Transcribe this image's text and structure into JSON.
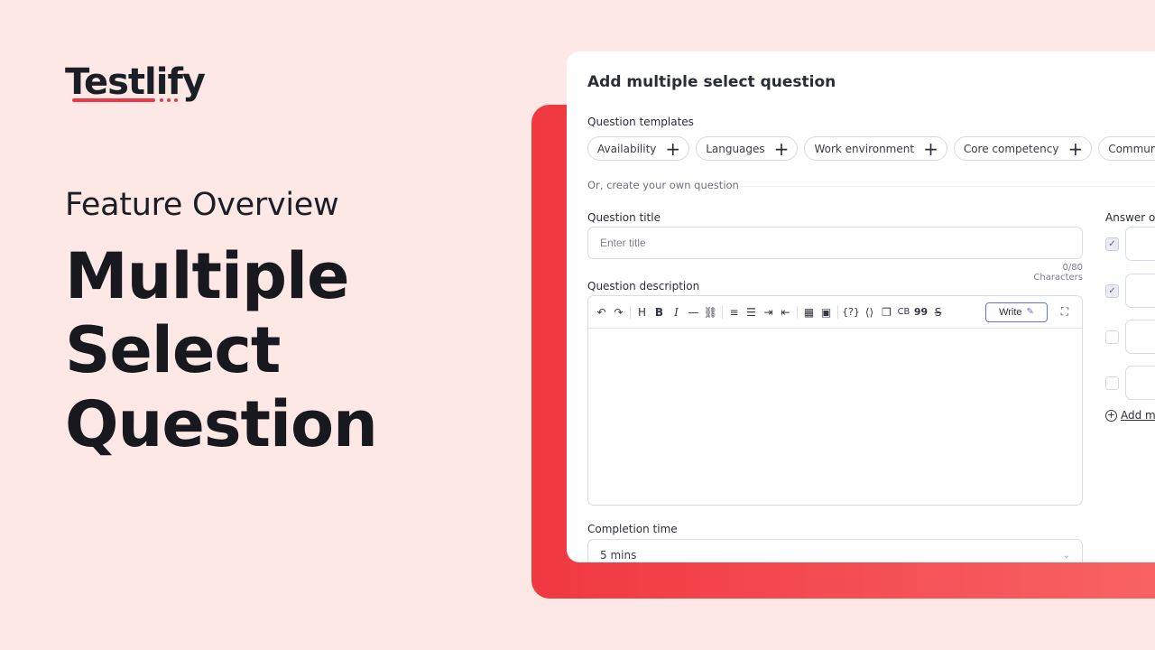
{
  "brand": {
    "logo_text": "Testlify",
    "accent": "#ec3a44"
  },
  "hero": {
    "eyebrow": "Feature Overview",
    "headline_lines": [
      "Multiple",
      "Select",
      "Question"
    ]
  },
  "card": {
    "title": "Add multiple select question",
    "templates_label": "Question templates",
    "templates": [
      {
        "label": "Availability"
      },
      {
        "label": "Languages"
      },
      {
        "label": "Work environment"
      },
      {
        "label": "Core competency"
      },
      {
        "label": "Communication"
      }
    ],
    "template_add_icon": "plus-icon",
    "or_text": "Or, create your own question",
    "question_title": {
      "label": "Question title",
      "placeholder": "Enter title",
      "value": "",
      "counter": "0/80 Characters"
    },
    "question_description": {
      "label": "Question description",
      "toolbar": {
        "undo": "↶",
        "redo": "↷",
        "heading": "H",
        "bold": "B",
        "italic": "I",
        "hr": "—",
        "link": "⛓",
        "ordered_list": "≡",
        "bullet_list": "☰",
        "indent": "⇥",
        "outdent": "⇤",
        "table": "▦",
        "image": "▣",
        "formula": "{?}",
        "code_inline": "⟨⟩",
        "copy": "❐",
        "code_block": "CB",
        "quote": "99",
        "strike": "S",
        "write_label": "Write",
        "write_icon": "✎",
        "expand": "⛶"
      }
    },
    "completion_time": {
      "label": "Completion time",
      "value": "5 mins"
    },
    "answer_options": {
      "label": "Answer op",
      "options": [
        {
          "checked": true
        },
        {
          "checked": true
        },
        {
          "checked": false
        },
        {
          "checked": false
        }
      ],
      "add_more_label": "Add mo"
    }
  }
}
